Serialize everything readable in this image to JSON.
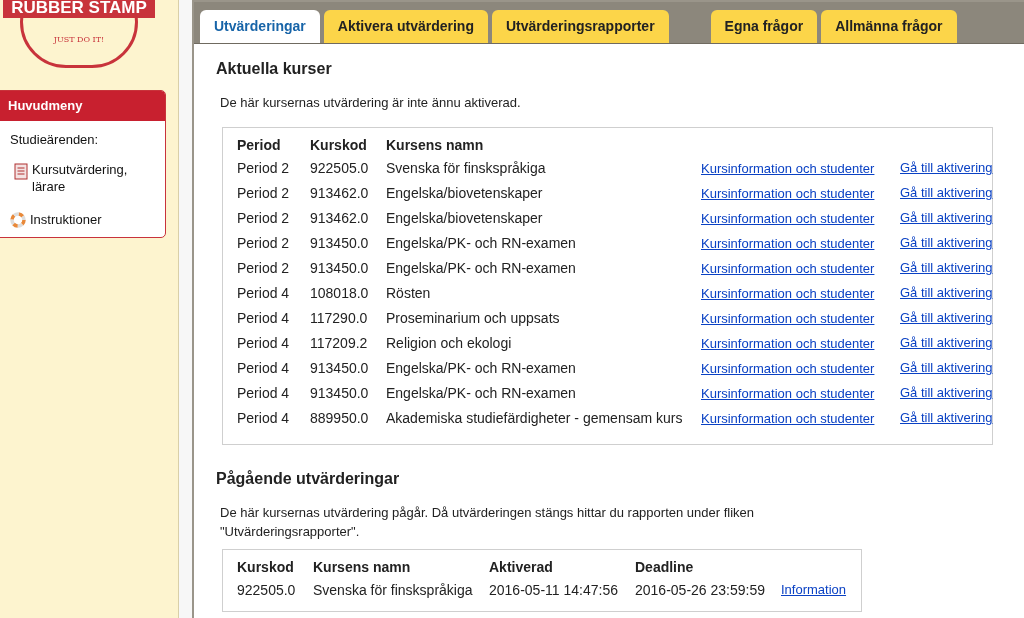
{
  "logo": {
    "title": "RUBBER STAMP",
    "tagline": "JUST DO IT!"
  },
  "sidebar": {
    "title": "Huvudmeny",
    "section_label": "Studieärenden:",
    "items": [
      {
        "label": "Kursutvärdering, lärare",
        "kind": "form"
      },
      {
        "label": "Instruktioner",
        "kind": "help"
      }
    ]
  },
  "tabs": [
    {
      "label": "Utvärderingar",
      "selected": true
    },
    {
      "label": "Aktivera utvärdering",
      "selected": false
    },
    {
      "label": "Utvärderingsrapporter",
      "selected": false
    },
    {
      "label": "Egna frågor",
      "selected": false
    },
    {
      "label": "Allmänna frågor",
      "selected": false
    }
  ],
  "current": {
    "heading": "Aktuella kurser",
    "description": "De här kursernas utvärdering är inte ännu aktiverad.",
    "columns": [
      "Period",
      "Kurskod",
      "Kursens namn"
    ],
    "rows": [
      {
        "period": "Period 2",
        "code": "922505.0",
        "name": "Svenska för finskspråkiga",
        "info_link": "Kursinformation och studenter",
        "activate_link": "Gå till aktivering"
      },
      {
        "period": "Period 2",
        "code": "913462.0",
        "name": "Engelska/biovetenskaper",
        "info_link": "Kursinformation och studenter",
        "activate_link": "Gå till aktivering"
      },
      {
        "period": "Period 2",
        "code": "913462.0",
        "name": "Engelska/biovetenskaper",
        "info_link": "Kursinformation och studenter",
        "activate_link": "Gå till aktivering"
      },
      {
        "period": "Period 2",
        "code": "913450.0",
        "name": "Engelska/PK- och RN-examen",
        "info_link": "Kursinformation och studenter",
        "activate_link": "Gå till aktivering"
      },
      {
        "period": "Period 2",
        "code": "913450.0",
        "name": "Engelska/PK- och RN-examen",
        "info_link": "Kursinformation och studenter",
        "activate_link": "Gå till aktivering"
      },
      {
        "period": "Period 4",
        "code": "108018.0",
        "name": "Rösten",
        "info_link": "Kursinformation och studenter",
        "activate_link": "Gå till aktivering"
      },
      {
        "period": "Period 4",
        "code": "117290.0",
        "name": "Proseminarium och uppsats",
        "info_link": "Kursinformation och studenter",
        "activate_link": "Gå till aktivering"
      },
      {
        "period": "Period 4",
        "code": "117209.2",
        "name": "Religion och ekologi",
        "info_link": "Kursinformation och studenter",
        "activate_link": "Gå till aktivering"
      },
      {
        "period": "Period 4",
        "code": "913450.0",
        "name": "Engelska/PK- och RN-examen",
        "info_link": "Kursinformation och studenter",
        "activate_link": "Gå till aktivering"
      },
      {
        "period": "Period 4",
        "code": "913450.0",
        "name": "Engelska/PK- och RN-examen",
        "info_link": "Kursinformation och studenter",
        "activate_link": "Gå till aktivering"
      },
      {
        "period": "Period 4",
        "code": "889950.0",
        "name": "Akademiska studiefärdigheter - gemensam kurs",
        "info_link": "Kursinformation och studenter",
        "activate_link": "Gå till aktivering"
      }
    ]
  },
  "ongoing": {
    "heading": "Pågående utvärderingar",
    "description": "De här kursernas utvärdering pågår. Då utvärderingen stängs hittar du rapporten under fliken \"Utvärderingsrapporter\".",
    "columns": [
      "Kurskod",
      "Kursens namn",
      "Aktiverad",
      "Deadline"
    ],
    "rows": [
      {
        "code": "922505.0",
        "name": "Svenska för finskspråkiga",
        "activated": "2016-05-11 14:47:56",
        "deadline": "2016-05-26 23:59:59",
        "link": "Information"
      }
    ]
  }
}
